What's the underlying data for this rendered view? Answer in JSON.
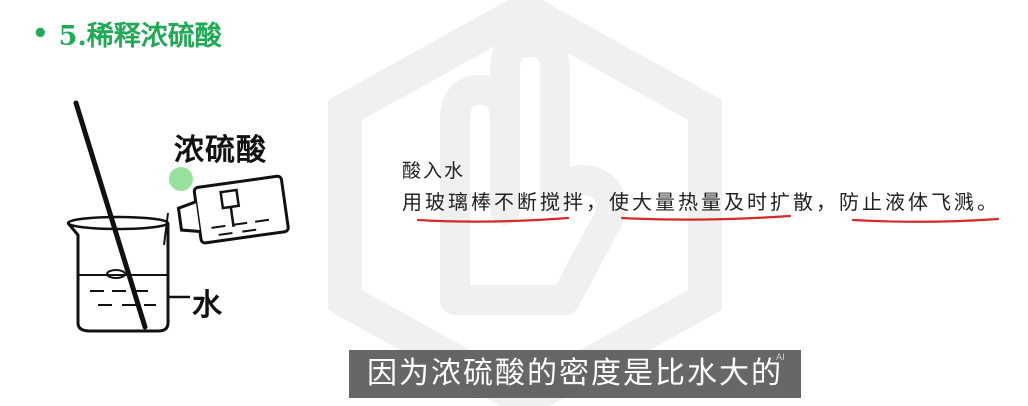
{
  "slide": {
    "bullet": "•",
    "title": "5.稀释浓硫酸"
  },
  "diagram": {
    "acid_label": "浓硫酸",
    "water_label": "水"
  },
  "notes": {
    "line1": "酸入水",
    "line2_part1": "用玻璃棒不断搅拌，",
    "line2_part2": "使大量热量及时扩散，",
    "line2_part3": "防止液体飞溅。"
  },
  "subtitle": {
    "text": "因为浓硫酸的密度是比水大的",
    "ai_tag": "AI"
  },
  "colors": {
    "title": "#1faa55",
    "underline": "#d42a2a",
    "watermark": "#f0f0f0",
    "subtitle_bg": "#464646"
  }
}
